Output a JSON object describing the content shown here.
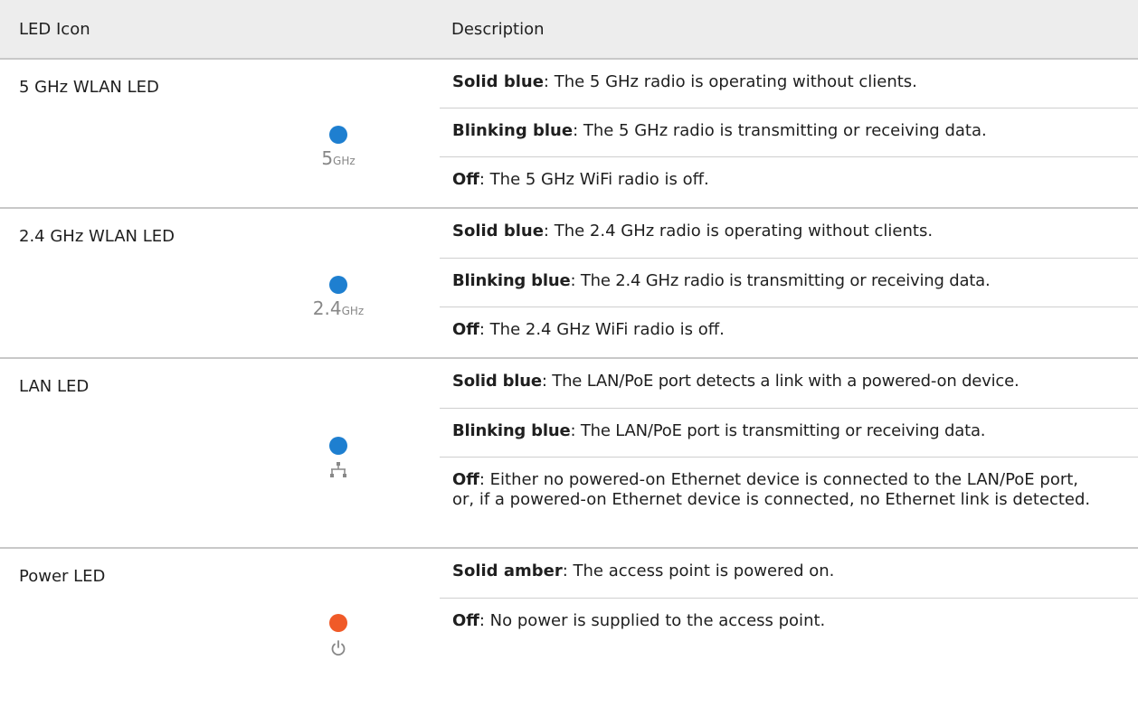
{
  "header": {
    "col_icon": "LED Icon",
    "col_desc": "Description"
  },
  "groups": [
    {
      "name": "5 GHz WLAN LED",
      "icon": {
        "name": "5ghz-icon",
        "dot_color": "#1e7fd0",
        "main": "5",
        "sub": "GHz"
      },
      "rows": [
        {
          "state": "Solid blue",
          "text": ": The 5 GHz radio is operating without clients."
        },
        {
          "state": "Blinking blue",
          "text": ": The 5 GHz radio is transmitting or receiving data."
        },
        {
          "state": "Off",
          "text": ": The 5 GHz WiFi radio is off."
        }
      ]
    },
    {
      "name": "2.4 GHz WLAN LED",
      "icon": {
        "name": "2-4ghz-icon",
        "dot_color": "#1e7fd0",
        "main": "2.4",
        "sub": "GHz"
      },
      "rows": [
        {
          "state": "Solid blue",
          "text": ": The 2.4 GHz radio is operating without clients."
        },
        {
          "state": "Blinking blue",
          "text": ": The 2.4 GHz radio is transmitting or receiving data."
        },
        {
          "state": "Off",
          "text": ": The 2.4 GHz WiFi radio is off."
        }
      ]
    },
    {
      "name": "LAN LED",
      "icon": {
        "name": "network-icon",
        "dot_color": "#1e7fd0"
      },
      "rows": [
        {
          "state": "Solid blue",
          "text": ": The LAN/PoE port detects a link with a powered-on device."
        },
        {
          "state": "Blinking blue",
          "text": ": The LAN/PoE port is transmitting or receiving data."
        },
        {
          "state": "Off",
          "text": ": Either no powered-on Ethernet device is connected to the LAN/PoE port, or, if a powered-on Ethernet device is connected, no Ethernet link is detected."
        }
      ]
    },
    {
      "name": "Power LED",
      "icon": {
        "name": "power-icon",
        "dot_color": "#f05a28"
      },
      "rows": [
        {
          "state": "Solid amber",
          "text": ": The access point is powered on."
        },
        {
          "state": "Off",
          "text": ": No power is supplied to the access point."
        }
      ]
    }
  ]
}
